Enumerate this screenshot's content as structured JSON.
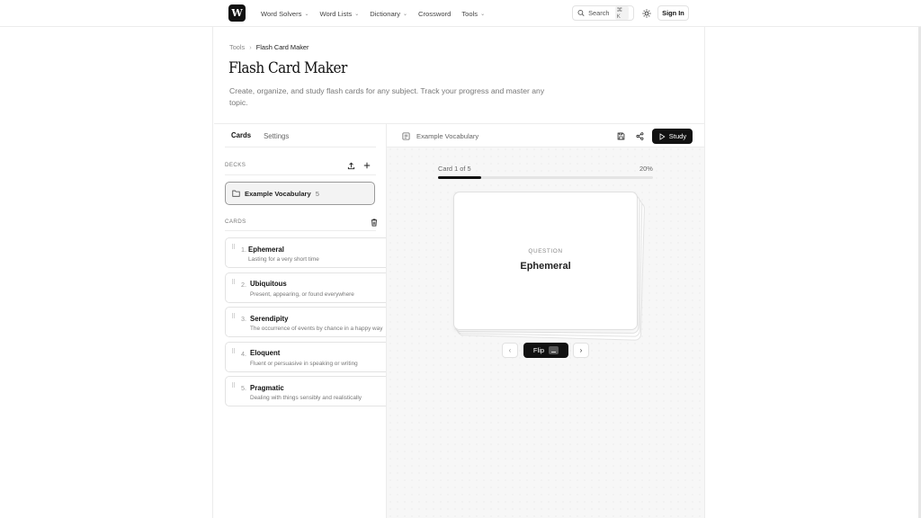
{
  "header": {
    "logo_text": "W",
    "nav": [
      {
        "label": "Word Solvers",
        "has_menu": true
      },
      {
        "label": "Word Lists",
        "has_menu": true
      },
      {
        "label": "Dictionary",
        "has_menu": true
      },
      {
        "label": "Crossword",
        "has_menu": false
      },
      {
        "label": "Tools",
        "has_menu": true
      }
    ],
    "search_label": "Search",
    "search_shortcut": "⌘ K",
    "theme_icon": "sun-icon",
    "signin_label": "Sign In"
  },
  "breadcrumb": {
    "parent": "Tools",
    "separator": ">",
    "current": "Flash Card Maker"
  },
  "page": {
    "title": "Flash Card Maker",
    "description": "Create, organize, and study flash cards for any subject. Track your progress and master any topic."
  },
  "left_panel": {
    "tabs": [
      "Cards",
      "Settings"
    ],
    "active_tab": "Cards",
    "decks_label": "DECKS",
    "cards_label": "CARDS",
    "deck": {
      "name": "Example Vocabulary",
      "count": "5"
    },
    "cards": [
      {
        "num": "1.",
        "term": "Ephemeral",
        "definition": "Lasting for a very short time"
      },
      {
        "num": "2.",
        "term": "Ubiquitous",
        "definition": "Present, appearing, or found everywhere"
      },
      {
        "num": "3.",
        "term": "Serendipity",
        "definition": "The occurrence of events by chance in a happy way"
      },
      {
        "num": "4.",
        "term": "Eloquent",
        "definition": "Fluent or persuasive in speaking or writing"
      },
      {
        "num": "5.",
        "term": "Pragmatic",
        "definition": "Dealing with things sensibly and realistically"
      }
    ]
  },
  "study_panel": {
    "deck_name": "Example Vocabulary",
    "study_label": "Study",
    "progress_label": "Card 1 of 5",
    "progress_pct": "20%",
    "progress_fraction": 0.2,
    "card_side_label": "QUESTION",
    "card_word": "Ephemeral",
    "flip_label": "Flip",
    "prev_icon": "‹",
    "next_icon": "›"
  }
}
